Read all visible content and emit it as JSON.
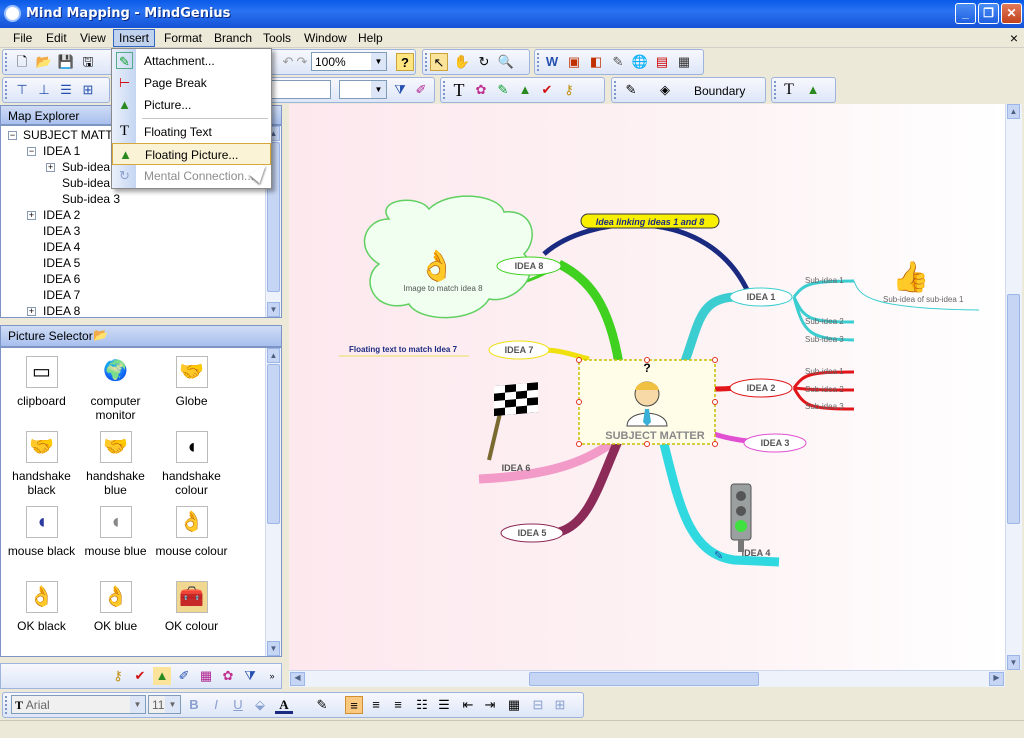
{
  "window": {
    "title": "Mind Mapping - MindGenius",
    "minimize": "_",
    "restore": "❐",
    "close": "✕"
  },
  "menubar": {
    "items": [
      "File",
      "Edit",
      "View",
      "Insert",
      "Format",
      "Branch",
      "Tools",
      "Window",
      "Help"
    ],
    "mdi_close": "×"
  },
  "toolbar": {
    "zoom": "100%",
    "boundary": "Boundary",
    "font": "Arial",
    "font_size": "11",
    "help_glyph": "?"
  },
  "insert_menu": {
    "items": [
      {
        "label": "Attachment...",
        "icon": "attachment-icon"
      },
      {
        "label": "Page Break",
        "icon": "page-break-icon"
      },
      {
        "label": "Picture...",
        "icon": "picture-icon"
      },
      {
        "label": "Floating Text",
        "icon": "floating-text-icon"
      },
      {
        "label": "Floating Picture...",
        "icon": "floating-picture-icon"
      },
      {
        "label": "Mental Connection...",
        "icon": "mental-connection-icon"
      }
    ]
  },
  "map_explorer": {
    "title": "Map Explorer",
    "tree": [
      "SUBJECT MATTER",
      "IDEA 1",
      "Sub-idea 1",
      "Sub-idea 2",
      "Sub-idea 3",
      "IDEA 2",
      "IDEA 3",
      "IDEA 4",
      "IDEA 5",
      "IDEA 6",
      "IDEA 7",
      "IDEA 8"
    ]
  },
  "picture_selector": {
    "title": "Picture Selector",
    "pictures": [
      [
        "clipboard"
      ],
      [
        "computer",
        "monitor"
      ],
      [
        "Globe"
      ],
      [
        "handshake",
        "black"
      ],
      [
        "handshake",
        "blue"
      ],
      [
        "handshake",
        "colour"
      ],
      [
        "mouse black"
      ],
      [
        "mouse blue"
      ],
      [
        "mouse colour"
      ],
      [
        "OK black"
      ],
      [
        "OK blue"
      ],
      [
        "OK colour"
      ]
    ]
  },
  "mindmap": {
    "central": "SUBJECT MATTER",
    "central_mark": "?",
    "ideas": [
      "IDEA 1",
      "IDEA 2",
      "IDEA 3",
      "IDEA 4",
      "IDEA 5",
      "IDEA 6",
      "IDEA 7",
      "IDEA 8"
    ],
    "idea1_subs": [
      "Sub-idea 1",
      "Sub-idea 2",
      "Sub-idea 3"
    ],
    "idea2_subs": [
      "Sub-idea 1",
      "Sub-idea 2",
      "Sub-idea 3"
    ],
    "sub_sub": "Sub-idea of sub-idea 1",
    "link_label": "Idea linking ideas 1 and 8",
    "floating_text": "Floating text to match Idea 7",
    "image_caption": "Image to match idea 8"
  },
  "colors": {
    "idea1": "#3ccdd0",
    "idea2": "#e0161a",
    "idea3": "#e050d0",
    "idea4": "#30d8e0",
    "idea5": "#8c2a58",
    "idea6": "#f29ac8",
    "idea7": "#f0e010",
    "idea8": "#40d020",
    "link": "#1a2a80",
    "titlebar": "#0a5ae8"
  }
}
